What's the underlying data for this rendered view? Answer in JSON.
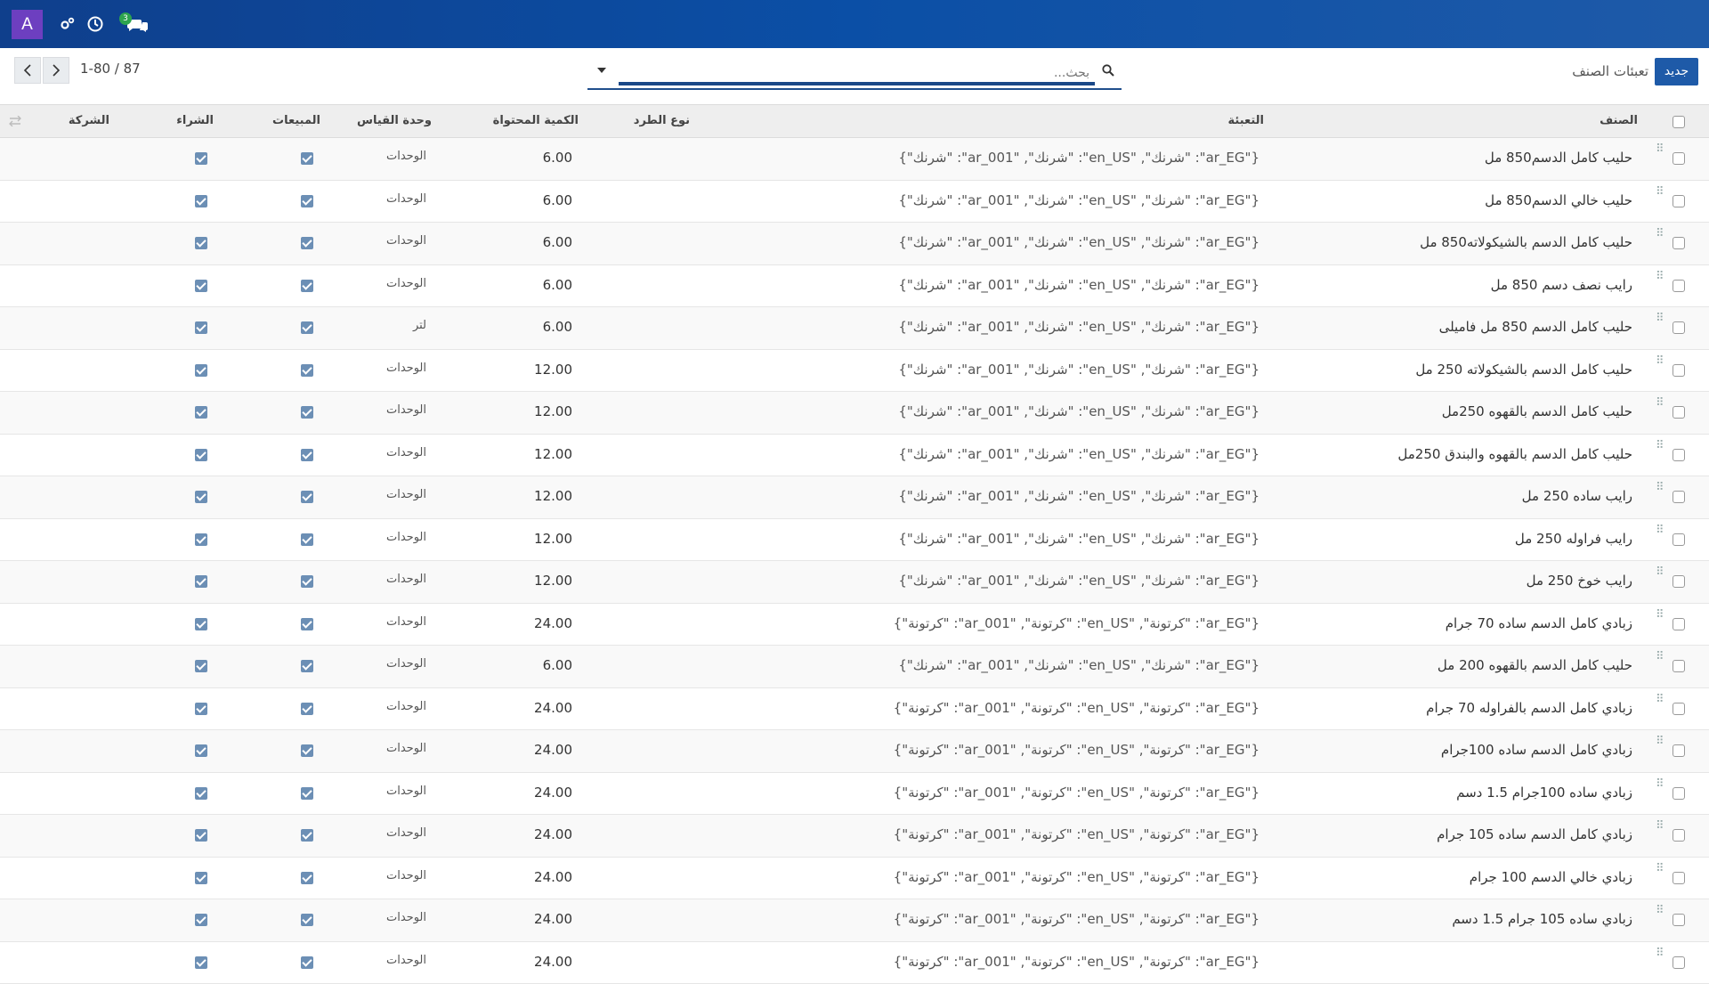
{
  "navbar": {
    "avatar_letter": "A",
    "badge_count": "3",
    "colors": {
      "bar": "#0b4fa6",
      "avatar": "#6d3fc0",
      "badge": "#2da44e"
    }
  },
  "control_panel": {
    "new_button": "جديد",
    "breadcrumb": "تعبئات الصنف",
    "search_placeholder": "بحث...",
    "pager": "1-80 / 87"
  },
  "table": {
    "headers": {
      "product": "الصنف",
      "packaging": "التعبئة",
      "package_type": "نوع الطرد",
      "qty": "الكمية المحتواة",
      "uom": "وحدة القياس",
      "sales": "المبيعات",
      "purchase": "الشراء",
      "company": "الشركة"
    },
    "rows": [
      {
        "product": "حليب كامل الدسم850 مل",
        "packaging": "{\"ar_EG\": \"شرنك\", \"en_US\": \"شرنك\", \"ar_001\": \"شرنك\"}",
        "qty": "6.00",
        "uom": "الوحدات"
      },
      {
        "product": "حليب خالي الدسم850 مل",
        "packaging": "{\"ar_EG\": \"شرنك\", \"en_US\": \"شرنك\", \"ar_001\": \"شرنك\"}",
        "qty": "6.00",
        "uom": "الوحدات"
      },
      {
        "product": "حليب كامل الدسم بالشيكولاته850 مل",
        "packaging": "{\"ar_EG\": \"شرنك\", \"en_US\": \"شرنك\", \"ar_001\": \"شرنك\"}",
        "qty": "6.00",
        "uom": "الوحدات"
      },
      {
        "product": "رايب نصف دسم 850 مل",
        "packaging": "{\"ar_EG\": \"شرنك\", \"en_US\": \"شرنك\", \"ar_001\": \"شرنك\"}",
        "qty": "6.00",
        "uom": "الوحدات"
      },
      {
        "product": "حليب كامل الدسم 850 مل فاميلى",
        "packaging": "{\"ar_EG\": \"شرنك\", \"en_US\": \"شرنك\", \"ar_001\": \"شرنك\"}",
        "qty": "6.00",
        "uom": "لتر"
      },
      {
        "product": "حليب كامل الدسم بالشيكولاته 250 مل",
        "packaging": "{\"ar_EG\": \"شرنك\", \"en_US\": \"شرنك\", \"ar_001\": \"شرنك\"}",
        "qty": "12.00",
        "uom": "الوحدات"
      },
      {
        "product": "حليب كامل الدسم بالقهوه 250مل",
        "packaging": "{\"ar_EG\": \"شرنك\", \"en_US\": \"شرنك\", \"ar_001\": \"شرنك\"}",
        "qty": "12.00",
        "uom": "الوحدات"
      },
      {
        "product": "حليب كامل الدسم بالقهوه والبندق 250مل",
        "packaging": "{\"ar_EG\": \"شرنك\", \"en_US\": \"شرنك\", \"ar_001\": \"شرنك\"}",
        "qty": "12.00",
        "uom": "الوحدات"
      },
      {
        "product": "رايب ساده 250 مل",
        "packaging": "{\"ar_EG\": \"شرنك\", \"en_US\": \"شرنك\", \"ar_001\": \"شرنك\"}",
        "qty": "12.00",
        "uom": "الوحدات"
      },
      {
        "product": "رايب فراوله 250 مل",
        "packaging": "{\"ar_EG\": \"شرنك\", \"en_US\": \"شرنك\", \"ar_001\": \"شرنك\"}",
        "qty": "12.00",
        "uom": "الوحدات"
      },
      {
        "product": "رايب خوخ 250 مل",
        "packaging": "{\"ar_EG\": \"شرنك\", \"en_US\": \"شرنك\", \"ar_001\": \"شرنك\"}",
        "qty": "12.00",
        "uom": "الوحدات"
      },
      {
        "product": "زبادي كامل الدسم ساده 70 جرام",
        "packaging": "{\"ar_EG\": \"كرتونة\", \"en_US\": \"كرتونة\", \"ar_001\": \"كرتونة\"}",
        "qty": "24.00",
        "uom": "الوحدات"
      },
      {
        "product": "حليب كامل الدسم بالقهوه 200 مل",
        "packaging": "{\"ar_EG\": \"شرنك\", \"en_US\": \"شرنك\", \"ar_001\": \"شرنك\"}",
        "qty": "6.00",
        "uom": "الوحدات"
      },
      {
        "product": "زبادي كامل الدسم بالفراوله 70 جرام",
        "packaging": "{\"ar_EG\": \"كرتونة\", \"en_US\": \"كرتونة\", \"ar_001\": \"كرتونة\"}",
        "qty": "24.00",
        "uom": "الوحدات"
      },
      {
        "product": "زبادي كامل الدسم ساده 100جرام",
        "packaging": "{\"ar_EG\": \"كرتونة\", \"en_US\": \"كرتونة\", \"ar_001\": \"كرتونة\"}",
        "qty": "24.00",
        "uom": "الوحدات"
      },
      {
        "product": "زبادي ساده 100جرام 1.5 دسم",
        "packaging": "{\"ar_EG\": \"كرتونة\", \"en_US\": \"كرتونة\", \"ar_001\": \"كرتونة\"}",
        "qty": "24.00",
        "uom": "الوحدات"
      },
      {
        "product": "زبادي كامل الدسم ساده 105 جرام",
        "packaging": "{\"ar_EG\": \"كرتونة\", \"en_US\": \"كرتونة\", \"ar_001\": \"كرتونة\"}",
        "qty": "24.00",
        "uom": "الوحدات"
      },
      {
        "product": "زبادي خالي الدسم 100 جرام",
        "packaging": "{\"ar_EG\": \"كرتونة\", \"en_US\": \"كرتونة\", \"ar_001\": \"كرتونة\"}",
        "qty": "24.00",
        "uom": "الوحدات"
      },
      {
        "product": "زبادي ساده 105 جرام 1.5 دسم",
        "packaging": "{\"ar_EG\": \"كرتونة\", \"en_US\": \"كرتونة\", \"ar_001\": \"كرتونة\"}",
        "qty": "24.00",
        "uom": "الوحدات"
      },
      {
        "product": "",
        "packaging": "{\"ar_EG\": \"كرتونة\", \"en_US\": \"كرتونة\", \"ar_001\": \"كرتونة\"}",
        "qty": "24.00",
        "uom": "الوحدات"
      }
    ]
  }
}
